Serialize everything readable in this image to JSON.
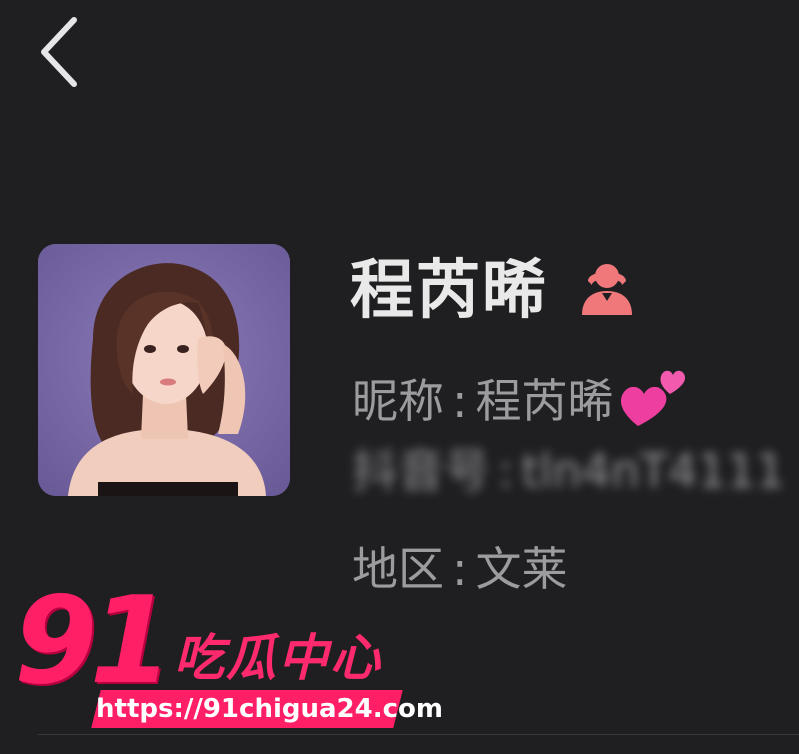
{
  "header": {
    "back_icon": "chevron-left-icon"
  },
  "profile": {
    "name": "程芮晞",
    "gender_icon": "female-user-icon",
    "nickname_label": "昵称",
    "nickname_value": "程芮晞",
    "nickname_emoji": "two-hearts-icon",
    "account_label": "抖音号",
    "account_value": "tln4nT4111",
    "region_label": "地区",
    "region_value": "文莱",
    "separator": ":"
  },
  "watermark": {
    "number": "91",
    "brand": "吃瓜中心",
    "url": "https://91chigua24.com"
  },
  "colors": {
    "background": "#1f1f21",
    "name_text": "#e9e9ea",
    "info_text": "#9c9c9f",
    "gender_icon": "#f0787a",
    "watermark_accent": "#ff1f67"
  }
}
